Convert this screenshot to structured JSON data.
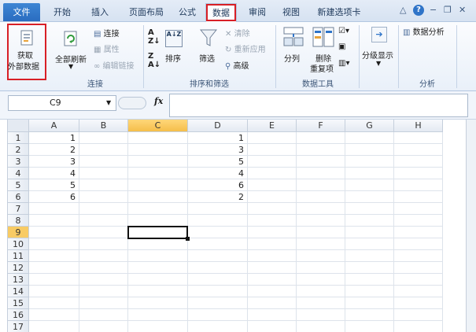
{
  "tabs": [
    "文件",
    "开始",
    "插入",
    "页面布局",
    "公式",
    "数据",
    "审阅",
    "视图",
    "新建选项卡"
  ],
  "active_tab": "数据",
  "help_label": "?",
  "ribbon": {
    "get_external_data": {
      "line1": "获取",
      "line2": "外部数据"
    },
    "refresh_all": "全部刷新",
    "connections": {
      "connect": "连接",
      "properties": "属性",
      "edit_links": "编辑链接"
    },
    "sort_asc_label": "A↓Z",
    "sort": "排序",
    "filter": "筛选",
    "filter_tools": {
      "clear": "清除",
      "reapply": "重新应用",
      "advanced": "高级"
    },
    "text_to_columns": "分列",
    "remove_duplicates": {
      "line1": "删除",
      "line2": "重复项"
    },
    "outline": "分级显示",
    "data_analysis": "数据分析",
    "groups": {
      "connections": "连接",
      "sort_filter": "排序和筛选",
      "data_tools": "数据工具",
      "analysis": "分析"
    }
  },
  "formula_bar": {
    "name_box": "C9",
    "fx_label": "fx",
    "formula": ""
  },
  "grid": {
    "columns": [
      "A",
      "B",
      "C",
      "D",
      "E",
      "F",
      "G",
      "H"
    ],
    "rows": [
      1,
      2,
      3,
      4,
      5,
      6,
      7,
      8,
      9,
      10,
      11,
      12,
      13,
      14,
      15,
      16,
      17
    ],
    "cells_A": [
      "1",
      "2",
      "3",
      "4",
      "5",
      "6"
    ],
    "cells_D": [
      "1",
      "3",
      "5",
      "4",
      "6",
      "2"
    ],
    "selected_column": "C",
    "selected_row": 9
  },
  "colors": {
    "highlight": "#d81f26",
    "file_tab": "#2a6cc0",
    "selected_header": "#f8cb64"
  }
}
